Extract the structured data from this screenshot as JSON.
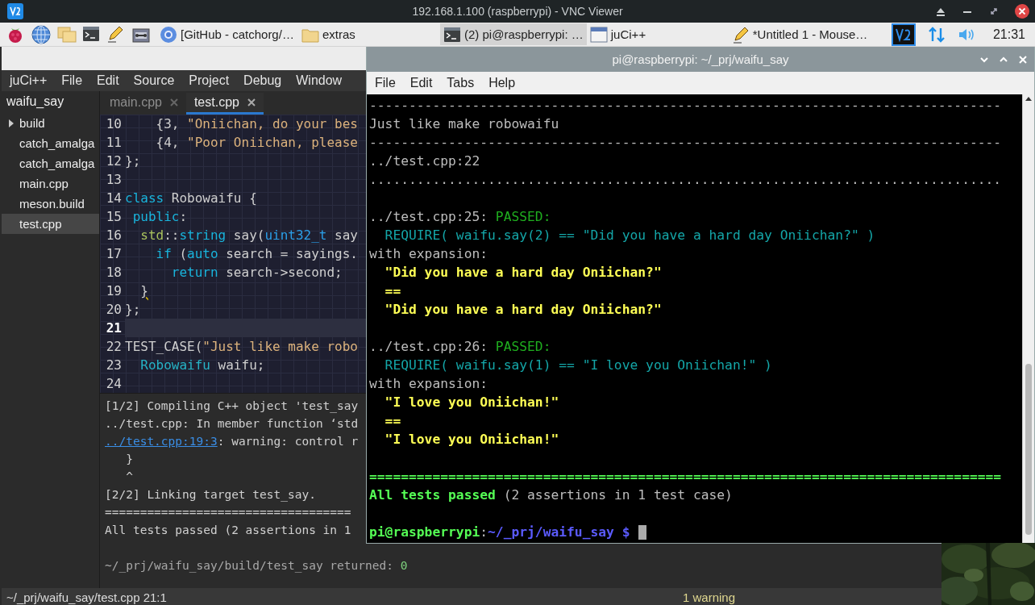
{
  "vnc_window": {
    "title": "192.168.1.100 (raspberrypi) - VNC Viewer"
  },
  "taskbar": {
    "tasks": [
      {
        "label": "[GitHub - catchorg/…",
        "kind": "browser",
        "selected": false
      },
      {
        "label": "extras",
        "kind": "folder",
        "selected": false
      },
      {
        "label": "(2) pi@raspberrypi: …",
        "kind": "terminal",
        "selected": true
      },
      {
        "label": "juCi++",
        "kind": "window",
        "selected": false
      },
      {
        "label": "*Untitled 1 - Mouse…",
        "kind": "editor",
        "selected": false
      }
    ],
    "clock": "21:31"
  },
  "juci": {
    "menu": [
      "juCi++",
      "File",
      "Edit",
      "Source",
      "Project",
      "Debug",
      "Window"
    ],
    "project": {
      "label": "waifu_say",
      "children": [
        {
          "label": "build",
          "kind": "folder",
          "expanded": false,
          "selected": false
        },
        {
          "label": "catch_amalga",
          "kind": "file",
          "selected": false
        },
        {
          "label": "catch_amalga",
          "kind": "file",
          "selected": false
        },
        {
          "label": "main.cpp",
          "kind": "file",
          "selected": false
        },
        {
          "label": "meson.build",
          "kind": "file",
          "selected": false
        },
        {
          "label": "test.cpp",
          "kind": "file",
          "selected": true
        }
      ]
    },
    "tabs": [
      {
        "label": "main.cpp",
        "selected": false
      },
      {
        "label": "test.cpp",
        "selected": true
      }
    ],
    "code": [
      {
        "number": "10",
        "current": false,
        "tokens": [
          {
            "text": "    {3, ",
            "kind": "plain"
          },
          {
            "text": "\"Oniichan, do your bes",
            "kind": "string"
          }
        ]
      },
      {
        "number": "11",
        "current": false,
        "tokens": [
          {
            "text": "    {4, ",
            "kind": "plain"
          },
          {
            "text": "\"Poor Oniichan, please",
            "kind": "string"
          }
        ]
      },
      {
        "number": "12",
        "current": false,
        "tokens": [
          {
            "text": "};",
            "kind": "plain"
          }
        ]
      },
      {
        "number": "13",
        "current": false
      },
      {
        "number": "14",
        "current": false,
        "tokens": [
          {
            "text": "class",
            "kind": "keyword"
          },
          {
            "text": " Robowaifu {",
            "kind": "plain"
          }
        ]
      },
      {
        "number": "15",
        "current": false,
        "tokens": [
          {
            "text": " public",
            "kind": "keyword"
          },
          {
            "text": ":",
            "kind": "plain"
          }
        ]
      },
      {
        "number": "16",
        "current": false,
        "tokens": [
          {
            "text": "  std",
            "kind": "namespace"
          },
          {
            "text": "::",
            "kind": "plain"
          },
          {
            "text": "string",
            "kind": "keyword"
          },
          {
            "text": " say(",
            "kind": "plain"
          },
          {
            "text": "uint32_t",
            "kind": "type"
          },
          {
            "text": " say",
            "kind": "plain"
          }
        ]
      },
      {
        "number": "17",
        "current": false,
        "tokens": [
          {
            "text": "    if",
            "kind": "keyword"
          },
          {
            "text": " (",
            "kind": "plain"
          },
          {
            "text": "auto",
            "kind": "keyword"
          },
          {
            "text": " search = sayings.",
            "kind": "plain"
          }
        ]
      },
      {
        "number": "18",
        "current": false,
        "tokens": [
          {
            "text": "      return",
            "kind": "keyword"
          },
          {
            "text": " search->second;",
            "kind": "plain"
          }
        ]
      },
      {
        "number": "19",
        "current": false,
        "tokens": [
          {
            "text": "  }",
            "kind": "warning"
          }
        ]
      },
      {
        "number": "20",
        "current": false,
        "tokens": [
          {
            "text": "};",
            "kind": "plain"
          }
        ]
      },
      {
        "number": "21",
        "current": true
      },
      {
        "number": "22",
        "current": false,
        "tokens": [
          {
            "text": "TEST_CASE(",
            "kind": "plain"
          },
          {
            "text": "\"Just like make robo",
            "kind": "string"
          }
        ]
      },
      {
        "number": "23",
        "current": false,
        "tokens": [
          {
            "text": "  Robowaifu",
            "kind": "class"
          },
          {
            "text": " waifu;",
            "kind": "plain"
          }
        ]
      },
      {
        "number": "24",
        "current": false
      }
    ],
    "output": [
      {
        "kind": "text",
        "segments": [
          {
            "text": "[1/2] Compiling C++ object 'test_say",
            "kind": "plain"
          }
        ]
      },
      {
        "kind": "text",
        "segments": [
          {
            "text": "../test.cpp: In member function ‘std",
            "kind": "plain"
          }
        ]
      },
      {
        "kind": "text",
        "segments": [
          {
            "text": "../test.cpp:19:3",
            "kind": "link"
          },
          {
            "text": ": warning: control r",
            "kind": "plain"
          }
        ]
      },
      {
        "kind": "text",
        "segments": [
          {
            "text": "   }",
            "kind": "plain"
          }
        ]
      },
      {
        "kind": "text",
        "segments": [
          {
            "text": "   ^",
            "kind": "plain"
          }
        ]
      },
      {
        "kind": "text",
        "segments": [
          {
            "text": "[2/2] Linking target test_say.",
            "kind": "plain"
          }
        ]
      },
      {
        "kind": "text",
        "segments": [
          {
            "text": "===================================",
            "kind": "plain"
          }
        ]
      },
      {
        "kind": "text",
        "segments": [
          {
            "text": "All tests passed (2 assertions in 1",
            "kind": "plain"
          }
        ]
      },
      {
        "kind": "blank"
      },
      {
        "kind": "text",
        "segments": [
          {
            "text": "~/_prj/waifu_say/build/test_say returned: ",
            "kind": "dim"
          },
          {
            "text": "0",
            "kind": "number"
          }
        ]
      }
    ],
    "status": {
      "path": "~/_prj/waifu_say/test.cpp 21:1",
      "warnings": "1 warning"
    }
  },
  "terminal": {
    "title": "pi@raspberrypi: ~/_prj/waifu_say",
    "menu": [
      "File",
      "Edit",
      "Tabs",
      "Help"
    ],
    "lines": [
      {
        "kind": "text",
        "segments": [
          {
            "text": "--------------------------------------------------------------------------------",
            "kind": "plain"
          }
        ]
      },
      {
        "kind": "text",
        "segments": [
          {
            "text": "Just like make robowaifu",
            "kind": "plain"
          }
        ]
      },
      {
        "kind": "text",
        "segments": [
          {
            "text": "--------------------------------------------------------------------------------",
            "kind": "plain"
          }
        ]
      },
      {
        "kind": "text",
        "segments": [
          {
            "text": "../test.cpp:22",
            "kind": "plain"
          }
        ]
      },
      {
        "kind": "text",
        "segments": [
          {
            "text": "................................................................................",
            "kind": "plain"
          }
        ]
      },
      {
        "kind": "blank"
      },
      {
        "kind": "text",
        "segments": [
          {
            "text": "../test.cpp:25: ",
            "kind": "plain"
          },
          {
            "text": "PASSED:",
            "kind": "green"
          }
        ]
      },
      {
        "kind": "text",
        "segments": [
          {
            "text": "  REQUIRE( waifu.say(2) == \"Did you have a hard day Oniichan?\" )",
            "kind": "cyan"
          }
        ]
      },
      {
        "kind": "text",
        "segments": [
          {
            "text": "with expansion:",
            "kind": "plain"
          }
        ]
      },
      {
        "kind": "text",
        "segments": [
          {
            "text": "  \"Did you have a hard day Oniichan?\"",
            "kind": "yellow"
          }
        ]
      },
      {
        "kind": "text",
        "segments": [
          {
            "text": "  ==",
            "kind": "yellow"
          }
        ]
      },
      {
        "kind": "text",
        "segments": [
          {
            "text": "  \"Did you have a hard day Oniichan?\"",
            "kind": "yellow"
          }
        ]
      },
      {
        "kind": "blank"
      },
      {
        "kind": "text",
        "segments": [
          {
            "text": "../test.cpp:26: ",
            "kind": "plain"
          },
          {
            "text": "PASSED:",
            "kind": "green"
          }
        ]
      },
      {
        "kind": "text",
        "segments": [
          {
            "text": "  REQUIRE( waifu.say(1) == \"I love you Oniichan!\" )",
            "kind": "cyan"
          }
        ]
      },
      {
        "kind": "text",
        "segments": [
          {
            "text": "with expansion:",
            "kind": "plain"
          }
        ]
      },
      {
        "kind": "text",
        "segments": [
          {
            "text": "  \"I love you Oniichan!\"",
            "kind": "yellow"
          }
        ]
      },
      {
        "kind": "text",
        "segments": [
          {
            "text": "  ==",
            "kind": "yellow"
          }
        ]
      },
      {
        "kind": "text",
        "segments": [
          {
            "text": "  \"I love you Oniichan!\"",
            "kind": "yellow"
          }
        ]
      },
      {
        "kind": "blank"
      },
      {
        "kind": "text",
        "segments": [
          {
            "text": "================================================================================",
            "kind": "bright"
          }
        ]
      },
      {
        "kind": "text",
        "segments": [
          {
            "text": "All tests passed",
            "kind": "bright"
          },
          {
            "text": " (2 assertions in 1 test case)",
            "kind": "plain"
          }
        ]
      },
      {
        "kind": "blank"
      },
      {
        "kind": "prompt",
        "segments": [
          {
            "text": "pi@raspberrypi",
            "kind": "bright"
          },
          {
            "text": ":",
            "kind": "plain"
          },
          {
            "text": "~/_prj/waifu_say $",
            "kind": "path"
          }
        ]
      }
    ]
  }
}
